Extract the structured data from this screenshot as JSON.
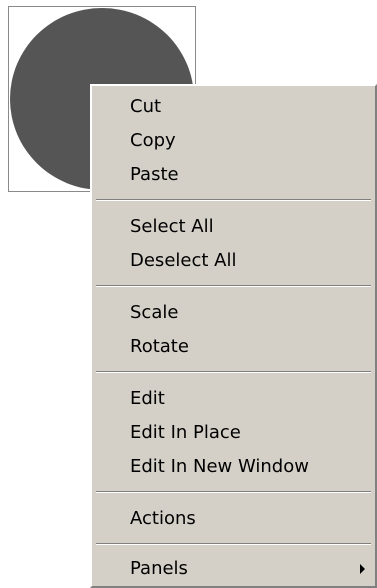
{
  "stage": {
    "shape_fill": "#555555",
    "bounding_box_color": "#8a8a8a"
  },
  "context_menu": {
    "background": "#d4d0c8",
    "groups": [
      {
        "items": [
          {
            "label": "Cut"
          },
          {
            "label": "Copy"
          },
          {
            "label": "Paste"
          }
        ]
      },
      {
        "items": [
          {
            "label": "Select All"
          },
          {
            "label": "Deselect All"
          }
        ]
      },
      {
        "items": [
          {
            "label": "Scale"
          },
          {
            "label": "Rotate"
          }
        ]
      },
      {
        "items": [
          {
            "label": "Edit"
          },
          {
            "label": "Edit In Place"
          },
          {
            "label": "Edit In New Window"
          }
        ]
      },
      {
        "items": [
          {
            "label": "Actions"
          }
        ]
      },
      {
        "items": [
          {
            "label": "Panels",
            "submenu_icon": "submenu-arrow-icon"
          }
        ]
      }
    ]
  }
}
